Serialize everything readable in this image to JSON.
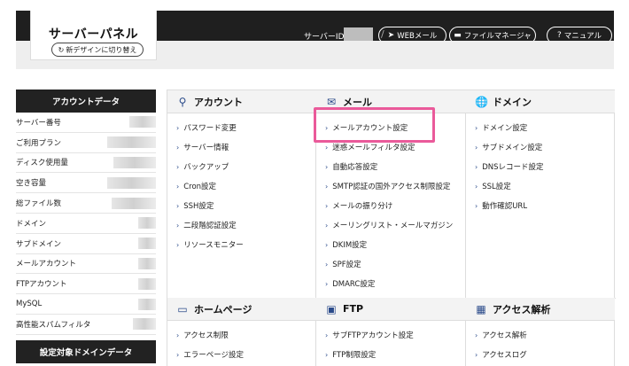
{
  "header": {
    "logo_title": "サーバーパネル",
    "new_design_label": "新デザインに切り替え",
    "server_id_label": "サーバーID",
    "slash": "/",
    "web_mail_label": "WEBメール",
    "file_manager_label": "ファイルマネージャ",
    "manual_label": "マニュアル"
  },
  "sidebar": {
    "account_data_title": "アカウントデータ",
    "rows": [
      {
        "label": "サーバー番号"
      },
      {
        "label": "ご利用プラン"
      },
      {
        "label": "ディスク使用量"
      },
      {
        "label": "空き容量"
      },
      {
        "label": "総ファイル数"
      },
      {
        "label": "ドメイン"
      },
      {
        "label": "サブドメイン"
      },
      {
        "label": "メールアカウント"
      },
      {
        "label": "FTPアカウント"
      },
      {
        "label": "MySQL"
      },
      {
        "label": "高性能スパムフィルタ"
      }
    ],
    "domain_data_title": "設定対象ドメインデータ"
  },
  "sections": {
    "account": {
      "title": "アカウント",
      "links": [
        "パスワード変更",
        "サーバー情報",
        "バックアップ",
        "Cron設定",
        "SSH設定",
        "二段階認証設定",
        "リソースモニター"
      ]
    },
    "mail": {
      "title": "メール",
      "links": [
        "メールアカウント設定",
        "迷惑メールフィルタ設定",
        "自動応答設定",
        "SMTP認証の国外アクセス制限設定",
        "メールの振り分け",
        "メーリングリスト・メールマガジン",
        "DKIM設定",
        "SPF設定",
        "DMARC設定"
      ]
    },
    "domain": {
      "title": "ドメイン",
      "links": [
        "ドメイン設定",
        "サブドメイン設定",
        "DNSレコード設定",
        "SSL設定",
        "動作確認URL"
      ]
    },
    "homepage": {
      "title": "ホームページ",
      "links": [
        "アクセス制限",
        "エラーページ設定"
      ]
    },
    "ftp": {
      "title": "FTP",
      "links": [
        "サブFTPアカウント設定",
        "FTP制限設定"
      ]
    },
    "access": {
      "title": "アクセス解析",
      "links": [
        "アクセス解析",
        "アクセスログ"
      ]
    }
  },
  "colors": {
    "header_bg": "#1f1f1f",
    "icon_blue": "#2a4a8a",
    "highlight_pink": "#ea5a9a"
  }
}
